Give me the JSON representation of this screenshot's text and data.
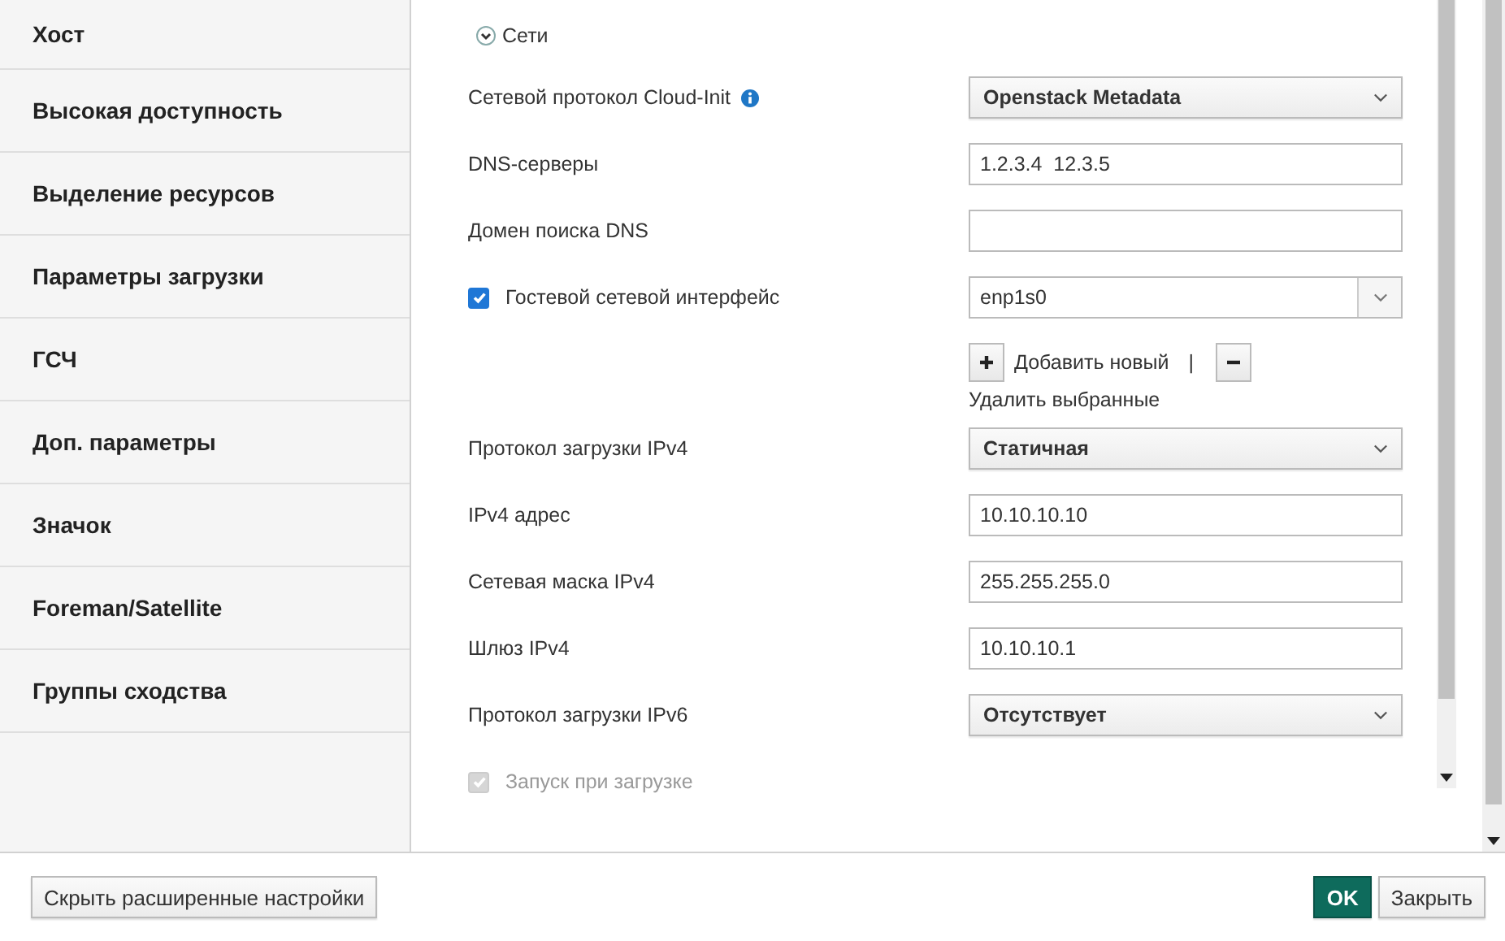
{
  "sidebar": {
    "items": [
      {
        "label": "Хост"
      },
      {
        "label": "Высокая доступность"
      },
      {
        "label": "Выделение ресурсов"
      },
      {
        "label": "Параметры загрузки"
      },
      {
        "label": "ГСЧ"
      },
      {
        "label": "Доп. параметры"
      },
      {
        "label": "Значок"
      },
      {
        "label": "Foreman/Satellite"
      },
      {
        "label": "Группы сходства"
      }
    ]
  },
  "section": {
    "title": "Сети",
    "expanded": true
  },
  "fields": [
    {
      "kind": "select",
      "label": "Сетевой протокол Cloud-Init",
      "info": true,
      "value": "Openstack Metadata"
    },
    {
      "kind": "text",
      "label": "DNS-серверы",
      "value": "1.2.3.4  12.3.5"
    },
    {
      "kind": "text",
      "label": "Домен поиска DNS"
    },
    {
      "kind": "combo",
      "label": "Гостевой сетевой интерфейс",
      "checked": true,
      "value": "enp1s0"
    },
    {
      "kind": "actions",
      "add_label": "Добавить новый",
      "separator": "|",
      "remove_label": "Удалить выбранные"
    },
    {
      "kind": "select",
      "label": "Протокол загрузки IPv4",
      "value": "Статичная"
    },
    {
      "kind": "text",
      "label": "IPv4 адрес",
      "value": "10.10.10.10"
    },
    {
      "kind": "text",
      "label": "Сетевая маска IPv4",
      "value": "255.255.255.0"
    },
    {
      "kind": "text",
      "label": "Шлюз IPv4",
      "value": "10.10.10.1"
    },
    {
      "kind": "select",
      "label": "Протокол загрузки IPv6",
      "value": "Отсутствует"
    },
    {
      "kind": "checkbox",
      "label": "Запуск при загрузке",
      "checked": true,
      "disabled": true
    }
  ],
  "footer": {
    "left_button": "Скрыть расширенные настройки",
    "ok": "OK",
    "close": "Закрыть"
  }
}
